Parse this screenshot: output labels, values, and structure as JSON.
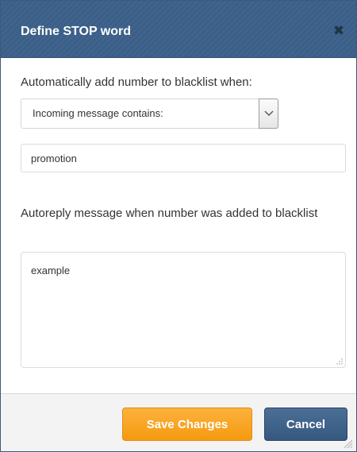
{
  "dialog": {
    "title": "Define STOP word",
    "close_icon": "close-icon"
  },
  "form": {
    "trigger_label": "Automatically add number to blacklist when:",
    "condition_select": {
      "selected": "Incoming message contains:",
      "icon": "chevron-down-icon"
    },
    "stop_word": {
      "value": "promotion",
      "placeholder": ""
    },
    "autoreply_label": "Autoreply message when number was added to blacklist",
    "autoreply_message": {
      "value": "example"
    }
  },
  "footer": {
    "save_label": "Save Changes",
    "cancel_label": "Cancel"
  },
  "colors": {
    "header_bg": "#3b5f88",
    "save_button": "#f7a11e",
    "cancel_button": "#3f6289"
  }
}
